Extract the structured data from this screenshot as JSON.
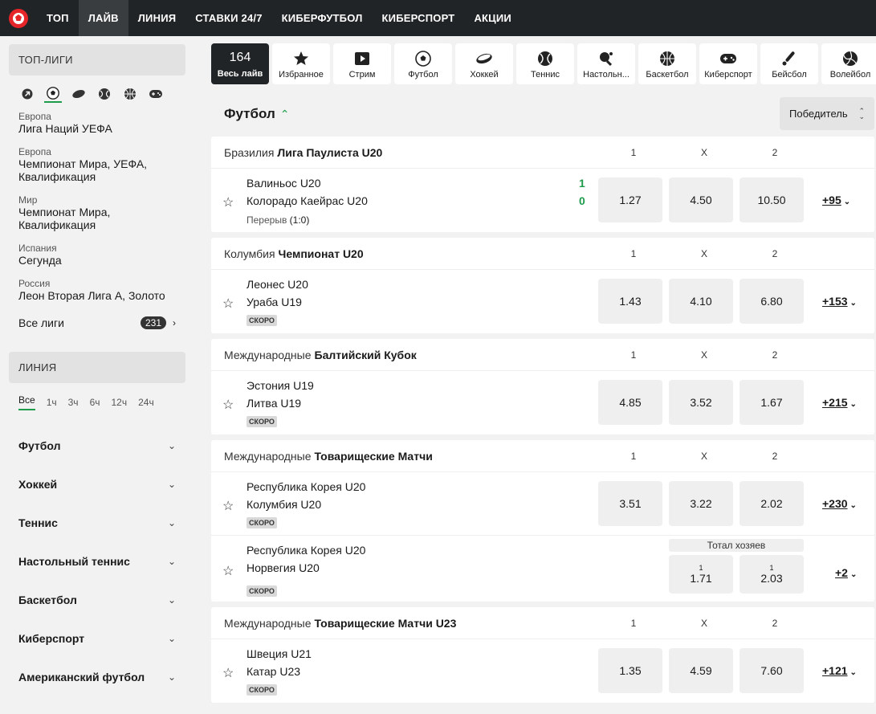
{
  "nav": {
    "items": [
      {
        "label": "ТОП",
        "active": false
      },
      {
        "label": "ЛАЙВ",
        "active": true
      },
      {
        "label": "ЛИНИЯ",
        "active": false
      },
      {
        "label": "СТАВКИ 24/7",
        "active": false
      },
      {
        "label": "КИБЕРФУТБОЛ",
        "active": false
      },
      {
        "label": "КИБЕРСПОРТ",
        "active": false
      },
      {
        "label": "АКЦИИ",
        "active": false
      }
    ]
  },
  "sidebar": {
    "top_leagues_title": "ТОП-ЛИГИ",
    "sport_icons": [
      "arrow-icon",
      "soccer-ball-icon",
      "hockey-puck-icon",
      "tennis-ball-icon",
      "basketball-icon",
      "gamepad-icon"
    ],
    "leagues": [
      {
        "region": "Европа",
        "name": "Лига Наций УЕФА"
      },
      {
        "region": "Европа",
        "name": "Чемпионат Мира, УЕФА, Квалификация"
      },
      {
        "region": "Мир",
        "name": "Чемпионат Мира, Квалификация"
      },
      {
        "region": "Испания",
        "name": "Сегунда"
      },
      {
        "region": "Россия",
        "name": "Леон Вторая Лига А, Золото"
      }
    ],
    "all_leagues_label": "Все лиги",
    "all_leagues_count": "231",
    "line_title": "ЛИНИЯ",
    "time_filters": [
      "Все",
      "1ч",
      "3ч",
      "6ч",
      "12ч",
      "24ч"
    ],
    "sports": [
      "Футбол",
      "Хоккей",
      "Теннис",
      "Настольный теннис",
      "Баскетбол",
      "Киберспорт",
      "Американский футбол"
    ]
  },
  "tabs": [
    {
      "count": "164",
      "label": "Весь лайв",
      "icon": ""
    },
    {
      "label": "Избранное",
      "icon": "star-icon"
    },
    {
      "label": "Стрим",
      "icon": "play-icon"
    },
    {
      "label": "Футбол",
      "icon": "soccer-ball-icon"
    },
    {
      "label": "Хоккей",
      "icon": "hockey-puck-icon"
    },
    {
      "label": "Теннис",
      "icon": "tennis-ball-icon"
    },
    {
      "label": "Настольн...",
      "icon": "table-tennis-icon"
    },
    {
      "label": "Баскетбол",
      "icon": "basketball-icon"
    },
    {
      "label": "Киберспорт",
      "icon": "gamepad-icon"
    },
    {
      "label": "Бейсбол",
      "icon": "baseball-icon"
    },
    {
      "label": "Волейбол",
      "icon": "volleyball-icon"
    }
  ],
  "main": {
    "section_title": "Футбол",
    "market_selector": "Победитель",
    "col_labels": [
      "1",
      "X",
      "2"
    ],
    "blocks": [
      {
        "region": "Бразилия",
        "league": "Лига Паулиста U20",
        "events": [
          {
            "team1": "Валиньос U20",
            "team2": "Колорадо Каейрас U20",
            "score1": "1",
            "score2": "0",
            "status": "Перерыв",
            "status_score": "(1:0)",
            "odds": [
              "1.27",
              "4.50",
              "10.50"
            ],
            "more": "+95"
          }
        ]
      },
      {
        "region": "Колумбия",
        "league": "Чемпионат U20",
        "events": [
          {
            "team1": "Леонес U20",
            "team2": "Ураба U19",
            "soon": "СКОРО",
            "odds": [
              "1.43",
              "4.10",
              "6.80"
            ],
            "more": "+153"
          }
        ]
      },
      {
        "region": "Международные",
        "league": "Балтийский Кубок",
        "events": [
          {
            "team1": "Эстония U19",
            "team2": "Литва U19",
            "soon": "СКОРО",
            "odds": [
              "4.85",
              "3.52",
              "1.67"
            ],
            "more": "+215"
          }
        ]
      },
      {
        "region": "Международные",
        "league": "Товарищеские Матчи",
        "events": [
          {
            "team1": "Республика Корея U20",
            "team2": "Колумбия U20",
            "soon": "СКОРО",
            "odds": [
              "3.51",
              "3.22",
              "2.02"
            ],
            "more": "+230"
          },
          {
            "team1": "Республика Корея U20",
            "team2": "Норвегия U20",
            "soon": "СКОРО",
            "market": "Тотал хозяев",
            "odds": [
              "1.71",
              "2.03"
            ],
            "odds_sup": [
              "1",
              "1"
            ],
            "more": "+2"
          }
        ]
      },
      {
        "region": "Международные",
        "league": "Товарищеские Матчи U23",
        "events": [
          {
            "team1": "Швеция U21",
            "team2": "Катар U23",
            "soon": "СКОРО",
            "odds": [
              "1.35",
              "4.59",
              "7.60"
            ],
            "more": "+121"
          }
        ]
      }
    ]
  },
  "colors": {
    "topbar": "#212426",
    "accent": "#1e9c4c",
    "background": "#f2f2f2"
  }
}
